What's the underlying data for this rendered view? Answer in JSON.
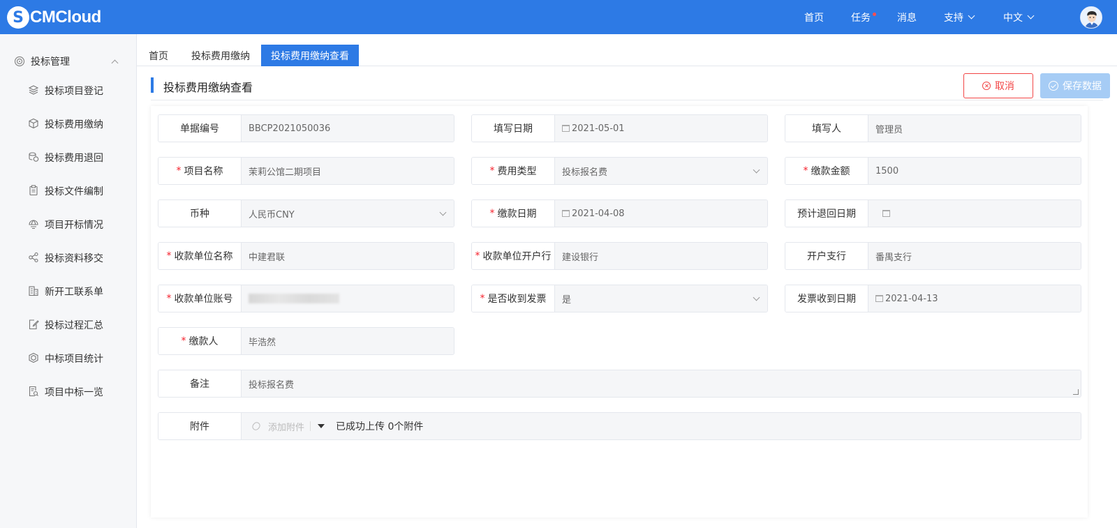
{
  "app": {
    "logo_mark": "S",
    "logo_text": "CMCloud"
  },
  "topnav": {
    "home": "首页",
    "tasks": "任务",
    "messages": "消息",
    "support": "支持",
    "language": "中文"
  },
  "sidebar": {
    "group_label": "投标管理",
    "items": [
      {
        "label": "投标项目登记",
        "icon": "layers-icon"
      },
      {
        "label": "投标费用缴纳",
        "icon": "cube-icon"
      },
      {
        "label": "投标费用退回",
        "icon": "coins-icon"
      },
      {
        "label": "投标文件编制",
        "icon": "clipboard-icon"
      },
      {
        "label": "项目开标情况",
        "icon": "globe-icon"
      },
      {
        "label": "投标资料移交",
        "icon": "share-icon"
      },
      {
        "label": "新开工联系单",
        "icon": "building-icon"
      },
      {
        "label": "投标过程汇总",
        "icon": "edit-doc-icon"
      },
      {
        "label": "中标项目统计",
        "icon": "hexagon-icon"
      },
      {
        "label": "项目中标一览",
        "icon": "doc-search-icon"
      }
    ]
  },
  "tabs": [
    {
      "label": "首页"
    },
    {
      "label": "投标费用缴纳"
    },
    {
      "label": "投标费用缴纳查看",
      "active": true
    }
  ],
  "page": {
    "title": "投标费用缴纳查看",
    "cancel_label": "取消",
    "save_label": "保存数据"
  },
  "form": {
    "doc_no": {
      "label": "单据编号",
      "value": "BBCP2021050036"
    },
    "fill_date": {
      "label": "填写日期",
      "value": "2021-05-01"
    },
    "filler": {
      "label": "填写人",
      "value": "管理员"
    },
    "project_name": {
      "label": "项目名称",
      "value": "茉莉公馆二期项目"
    },
    "fee_type": {
      "label": "费用类型",
      "value": "投标报名费"
    },
    "amount": {
      "label": "缴款金额",
      "value": "1500"
    },
    "currency": {
      "label": "币种",
      "value": "人民币CNY"
    },
    "pay_date": {
      "label": "缴款日期",
      "value": "2021-04-08"
    },
    "return_date": {
      "label": "预计退回日期",
      "value": ""
    },
    "payee_name": {
      "label": "收款单位名称",
      "value": "中建君联"
    },
    "payee_bank": {
      "label": "收款单位开户行",
      "value": "建设银行"
    },
    "branch": {
      "label": "开户支行",
      "value": "番禺支行"
    },
    "payee_account": {
      "label": "收款单位账号",
      "value": ""
    },
    "invoice_received": {
      "label": "是否收到发票",
      "value": "是"
    },
    "invoice_date": {
      "label": "发票收到日期",
      "value": "2021-04-13"
    },
    "payer": {
      "label": "缴款人",
      "value": "毕浩然"
    },
    "remark": {
      "label": "备注",
      "value": "投标报名费"
    },
    "attachment": {
      "label": "附件",
      "add_label": "添加附件",
      "status": "已成功上传 0个附件"
    }
  },
  "colors": {
    "primary": "#2d7ae5",
    "danger": "#f24545",
    "disabled": "#a6ccf5"
  }
}
